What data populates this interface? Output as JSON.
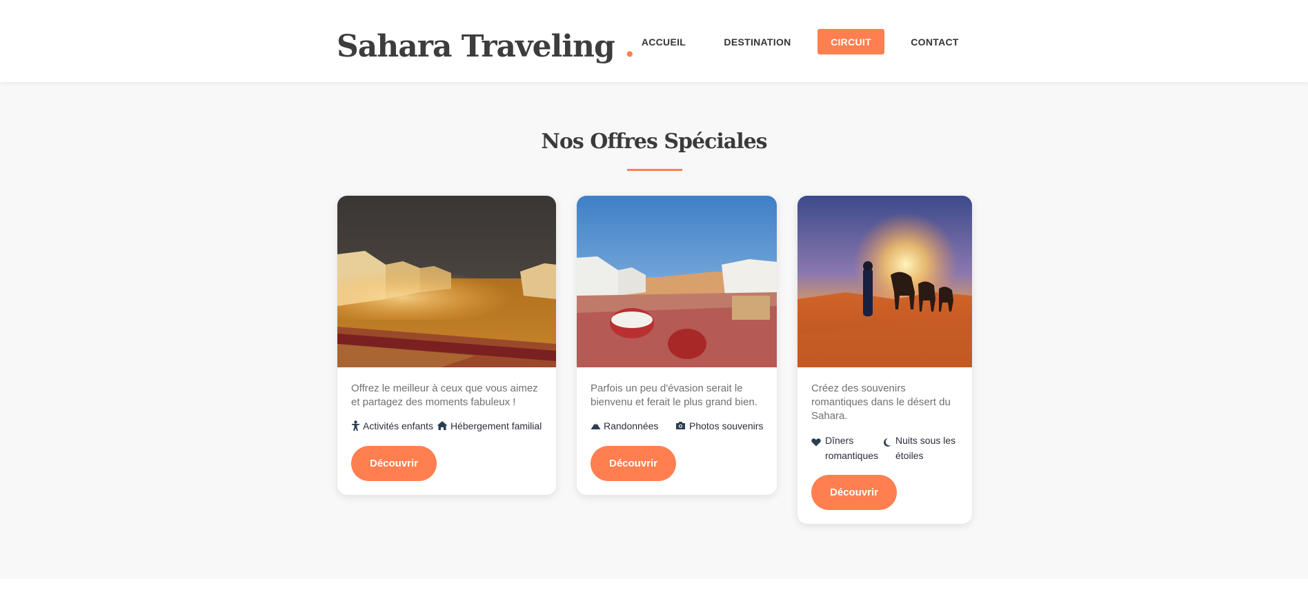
{
  "header": {
    "logo": "Sahara Traveling",
    "logo_dot": ".",
    "nav": [
      "ACCUEIL",
      "DESTINATION",
      "CIRCUIT",
      "CONTACT"
    ],
    "active_nav": "CIRCUIT"
  },
  "section": {
    "title": "Nos Offres Spéciales"
  },
  "cards": [
    {
      "description": "Offrez le meilleur à ceux que vous aimez et partagez des moments fabuleux !",
      "features": [
        {
          "icon": "child-icon",
          "label": "Activités enfants"
        },
        {
          "icon": "home-icon",
          "label": "Hébergement familial"
        }
      ],
      "button": "Découvrir",
      "image": "desert-camp-night-photo"
    },
    {
      "description": "Parfois un peu d'évasion serait le bienvenu et ferait le plus grand bien.",
      "features": [
        {
          "icon": "mountain-icon",
          "label": "Randonnées"
        },
        {
          "icon": "camera-icon",
          "label": "Photos souvenirs"
        }
      ],
      "button": "Découvrir",
      "image": "desert-camp-day-photo"
    },
    {
      "description": "Créez des souvenirs romantiques dans le désert du Sahara.",
      "features": [
        {
          "icon": "heart-icon",
          "label": "Dîners romantiques"
        },
        {
          "icon": "moon-icon",
          "label": "Nuits sous les étoiles"
        }
      ],
      "button": "Découvrir",
      "image": "camel-caravan-sunset-photo"
    }
  ],
  "colors": {
    "accent": "#ff7f50",
    "text": "#3d3d3d",
    "background": "#f8f8f8",
    "icon": "#2c3e50"
  }
}
